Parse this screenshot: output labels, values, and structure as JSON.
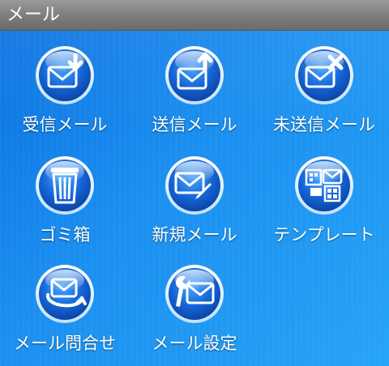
{
  "header": {
    "title": "メール"
  },
  "menu": {
    "items": [
      {
        "label": "受信メール",
        "icon": "inbox-mail-icon"
      },
      {
        "label": "送信メール",
        "icon": "sent-mail-icon"
      },
      {
        "label": "未送信メール",
        "icon": "unsent-mail-icon"
      },
      {
        "label": "ゴミ箱",
        "icon": "trash-icon"
      },
      {
        "label": "新規メール",
        "icon": "compose-mail-icon"
      },
      {
        "label": "テンプレート",
        "icon": "template-icon"
      },
      {
        "label": "メール問合せ",
        "icon": "mail-inquiry-icon"
      },
      {
        "label": "メール設定",
        "icon": "mail-settings-icon"
      }
    ]
  },
  "colors": {
    "background": "#1a86e6",
    "titlebar": "#7c7c7c",
    "orb": "#1466d8"
  }
}
